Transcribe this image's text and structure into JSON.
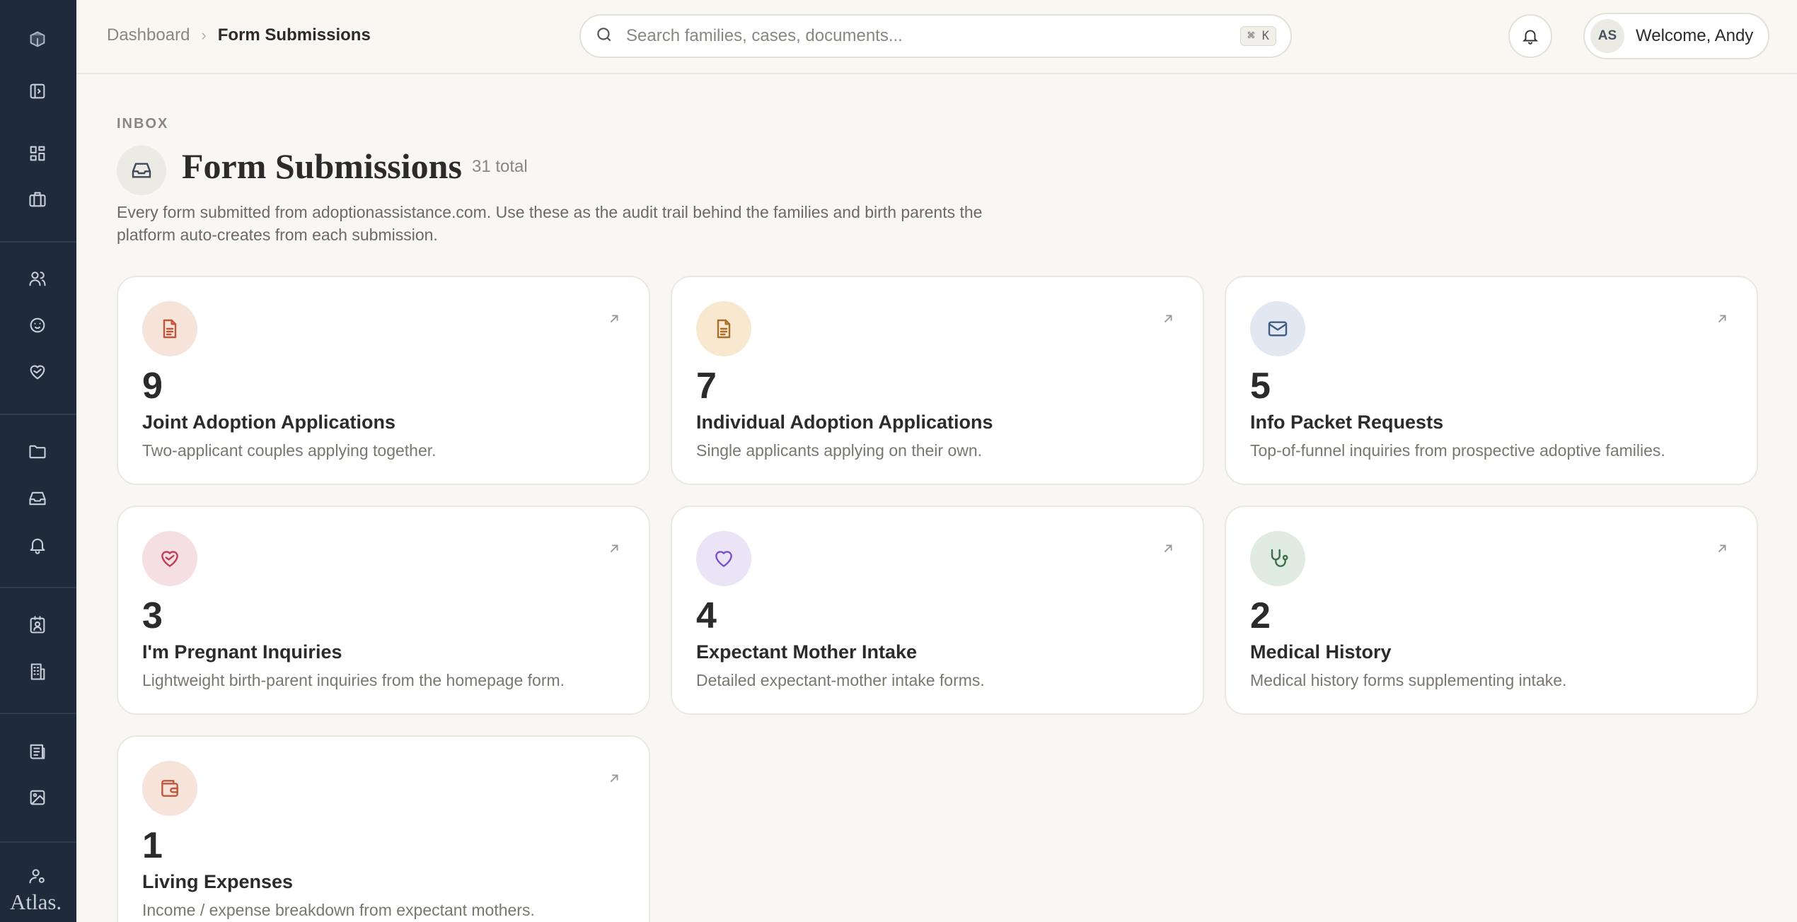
{
  "app": {
    "brand": "Atlas."
  },
  "header": {
    "breadcrumb": [
      "Dashboard",
      "Form Submissions"
    ],
    "search_placeholder": "Search families, cases, documents...",
    "search_shortcut": "⌘ K",
    "user_initials": "AS",
    "user_welcome": "Welcome, Andy"
  },
  "page": {
    "eyebrow": "INBOX",
    "title": "Form Submissions",
    "total": "31 total",
    "description": "Every form submitted from adoptionassistance.com. Use these as the audit trail behind the families and birth parents the platform auto-creates from each submission."
  },
  "cards": [
    {
      "count": "9",
      "title": "Joint Adoption Applications",
      "description": "Two-applicant couples applying together.",
      "icon": "document-icon",
      "icon_bg": "#f6e3da",
      "icon_color": "#c0573a"
    },
    {
      "count": "7",
      "title": "Individual Adoption Applications",
      "description": "Single applicants applying on their own.",
      "icon": "document-icon",
      "icon_bg": "#f7e8cf",
      "icon_color": "#a8702a"
    },
    {
      "count": "5",
      "title": "Info Packet Requests",
      "description": "Top-of-funnel inquiries from prospective adoptive families.",
      "icon": "mail-icon",
      "icon_bg": "#e2e8f2",
      "icon_color": "#3f5b82"
    },
    {
      "count": "3",
      "title": "I'm Pregnant Inquiries",
      "description": "Lightweight birth-parent inquiries from the homepage form.",
      "icon": "heart-handshake-icon",
      "icon_bg": "#f6dfe2",
      "icon_color": "#c33a55"
    },
    {
      "count": "4",
      "title": "Expectant Mother Intake",
      "description": "Detailed expectant-mother intake forms.",
      "icon": "heart-icon",
      "icon_bg": "#ebe3f6",
      "icon_color": "#7a4fcf"
    },
    {
      "count": "2",
      "title": "Medical History",
      "description": "Medical history forms supplementing intake.",
      "icon": "stethoscope-icon",
      "icon_bg": "#e0ebe2",
      "icon_color": "#3d6e4d"
    },
    {
      "count": "1",
      "title": "Living Expenses",
      "description": "Income / expense breakdown from expectant mothers.",
      "icon": "wallet-icon",
      "icon_bg": "#f6e3da",
      "icon_color": "#c0573a"
    }
  ]
}
